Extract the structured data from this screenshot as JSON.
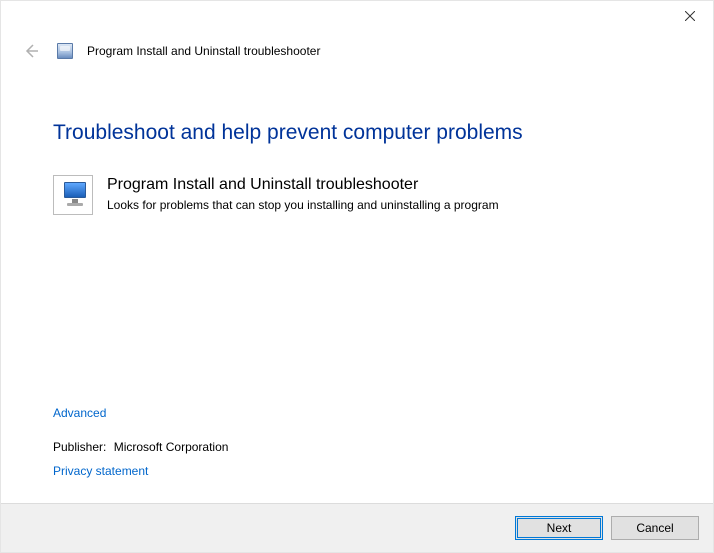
{
  "header": {
    "title": "Program Install and Uninstall troubleshooter"
  },
  "main": {
    "heading": "Troubleshoot and help prevent computer problems",
    "troubleshooter": {
      "title": "Program Install and Uninstall troubleshooter",
      "description": "Looks for problems that can stop you installing and uninstalling a program"
    },
    "advanced": "Advanced",
    "publisher_label": "Publisher:",
    "publisher_value": "Microsoft Corporation",
    "privacy": "Privacy statement"
  },
  "footer": {
    "next": "Next",
    "cancel": "Cancel"
  }
}
